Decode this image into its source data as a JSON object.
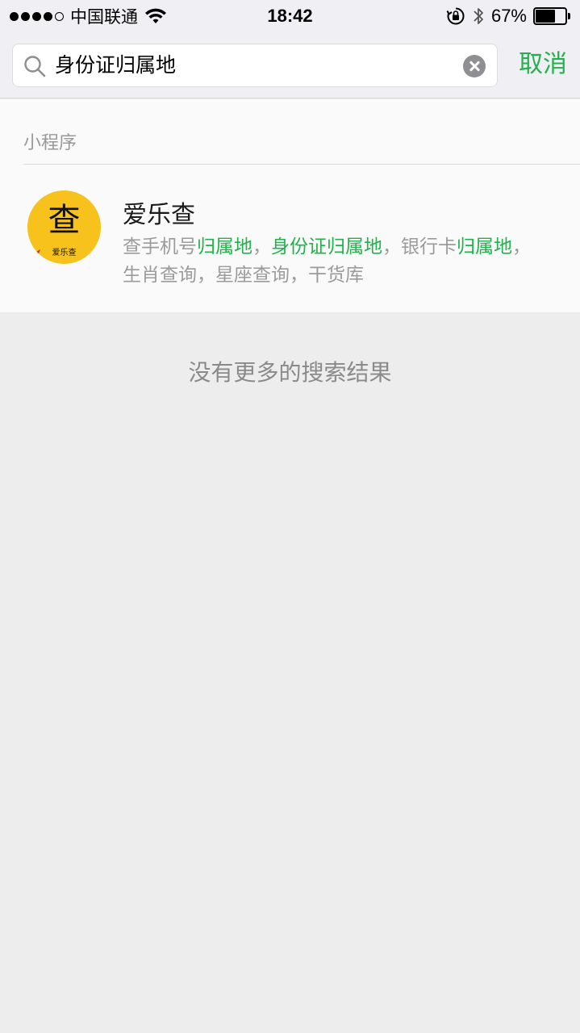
{
  "status_bar": {
    "carrier": "中国联通",
    "time": "18:42",
    "battery_percent": "67%",
    "battery_level": 0.67,
    "icons": [
      "signal-dots-icon",
      "wifi-icon",
      "rotation-lock-icon",
      "bluetooth-icon",
      "battery-icon"
    ]
  },
  "search": {
    "value": "身份证归属地",
    "cancel_label": "取消"
  },
  "colors": {
    "accent": "#22b14c",
    "app_icon_bg": "#f6c21b"
  },
  "results": {
    "section_title": "小程序",
    "items": [
      {
        "name": "爱乐查",
        "icon_glyph": "查",
        "icon_subtext": "爱乐查",
        "desc_parts": [
          {
            "text": "查手机号",
            "highlight": false
          },
          {
            "text": "归属地",
            "highlight": true
          },
          {
            "text": "，",
            "highlight": false
          },
          {
            "text": "身份证归属地",
            "highlight": true
          },
          {
            "text": "，银行卡",
            "highlight": false
          },
          {
            "text": "归属地",
            "highlight": true
          },
          {
            "text": "，生肖查询，星座查询，干货库",
            "highlight": false
          }
        ]
      }
    ]
  },
  "footer": {
    "no_more_text": "没有更多的搜索结果"
  }
}
